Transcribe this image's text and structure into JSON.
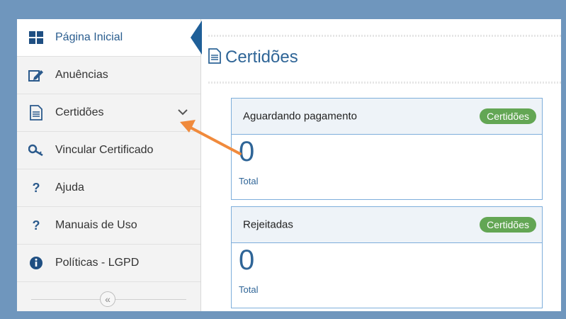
{
  "sidebar": {
    "items": [
      {
        "label": "Página Inicial",
        "icon": "dashboard-grid-icon"
      },
      {
        "label": "Anuências",
        "icon": "edit-icon"
      },
      {
        "label": "Certidões",
        "icon": "document-icon"
      },
      {
        "label": "Vincular Certificado",
        "icon": "key-icon"
      },
      {
        "label": "Ajuda",
        "icon": "question-icon"
      },
      {
        "label": "Manuais de Uso",
        "icon": "question-icon"
      },
      {
        "label": "Políticas - LGPD",
        "icon": "info-icon"
      }
    ],
    "collapse_glyph": "«"
  },
  "main": {
    "title": "Certidões",
    "cards": [
      {
        "title": "Aguardando pagamento",
        "badge": "Certidões",
        "count": "0",
        "count_label": "Total"
      },
      {
        "title": "Rejeitadas",
        "badge": "Certidões",
        "count": "0",
        "count_label": "Total"
      }
    ]
  },
  "colors": {
    "brand_blue": "#2f6597",
    "badge_green": "#63a654",
    "annotation_arrow": "#f08a3c",
    "outer_border": "#6f96bd"
  }
}
